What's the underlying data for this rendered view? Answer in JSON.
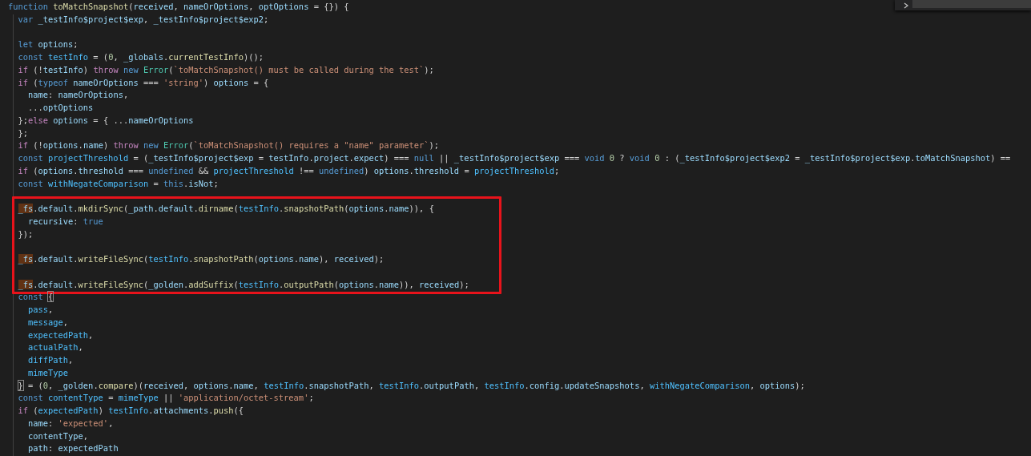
{
  "editor": {
    "groups": [
      {
        "boxed": false,
        "lines": [
          {
            "kind": "code",
            "tokens": [
              {
                "text": "function ",
                "kind": "kw"
              },
              {
                "text": "toMatchSnapshot",
                "kind": "fn"
              },
              {
                "text": "(",
                "kind": "p"
              },
              {
                "text": "received",
                "kind": "var"
              },
              {
                "text": ", ",
                "kind": "p"
              },
              {
                "text": "nameOrOptions",
                "kind": "var"
              },
              {
                "text": ", ",
                "kind": "p"
              },
              {
                "text": "optOptions",
                "kind": "var"
              },
              {
                "text": " = {}) {",
                "kind": "p"
              }
            ]
          },
          {
            "kind": "code",
            "tokens": [
              {
                "text": "  var ",
                "kind": "kw"
              },
              {
                "text": "_testInfo$project$exp",
                "kind": "var"
              },
              {
                "text": ", ",
                "kind": "p"
              },
              {
                "text": "_testInfo$project$exp2",
                "kind": "var"
              },
              {
                "text": ";",
                "kind": "p"
              }
            ]
          },
          {
            "kind": "blank"
          },
          {
            "kind": "code",
            "tokens": [
              {
                "text": "  let ",
                "kind": "kw"
              },
              {
                "text": "options",
                "kind": "var"
              },
              {
                "text": ";",
                "kind": "p"
              }
            ]
          },
          {
            "kind": "code",
            "tokens": [
              {
                "text": "  const ",
                "kind": "kw"
              },
              {
                "text": "testInfo",
                "kind": "const"
              },
              {
                "text": " = (",
                "kind": "p"
              },
              {
                "text": "0",
                "kind": "num"
              },
              {
                "text": ", ",
                "kind": "p"
              },
              {
                "text": "_globals",
                "kind": "var"
              },
              {
                "text": ".",
                "kind": "p"
              },
              {
                "text": "currentTestInfo",
                "kind": "fn"
              },
              {
                "text": ")();",
                "kind": "p"
              }
            ]
          },
          {
            "kind": "code",
            "tokens": [
              {
                "text": "  if",
                "kind": "ctl"
              },
              {
                "text": " (!",
                "kind": "p"
              },
              {
                "text": "testInfo",
                "kind": "var"
              },
              {
                "text": ") ",
                "kind": "p"
              },
              {
                "text": "throw ",
                "kind": "ctl"
              },
              {
                "text": "new ",
                "kind": "kw"
              },
              {
                "text": "Error",
                "kind": "cls"
              },
              {
                "text": "(",
                "kind": "p"
              },
              {
                "text": "`toMatchSnapshot() must be called during the test`",
                "kind": "str"
              },
              {
                "text": ");",
                "kind": "p"
              }
            ]
          },
          {
            "kind": "code",
            "tokens": [
              {
                "text": "  if",
                "kind": "ctl"
              },
              {
                "text": " (",
                "kind": "p"
              },
              {
                "text": "typeof ",
                "kind": "kw"
              },
              {
                "text": "nameOrOptions",
                "kind": "var"
              },
              {
                "text": " === ",
                "kind": "p"
              },
              {
                "text": "'string'",
                "kind": "str"
              },
              {
                "text": ") ",
                "kind": "p"
              },
              {
                "text": "options",
                "kind": "var"
              },
              {
                "text": " = {",
                "kind": "p"
              }
            ]
          },
          {
            "kind": "code",
            "tokens": [
              {
                "text": "    name",
                "kind": "var"
              },
              {
                "text": ": ",
                "kind": "p"
              },
              {
                "text": "nameOrOptions",
                "kind": "var"
              },
              {
                "text": ",",
                "kind": "p"
              }
            ]
          },
          {
            "kind": "code",
            "tokens": [
              {
                "text": "    ...",
                "kind": "p"
              },
              {
                "text": "optOptions",
                "kind": "var"
              }
            ]
          },
          {
            "kind": "code",
            "tokens": [
              {
                "text": "  };",
                "kind": "p"
              },
              {
                "text": "else ",
                "kind": "ctl"
              },
              {
                "text": "options",
                "kind": "var"
              },
              {
                "text": " = { ...",
                "kind": "p"
              },
              {
                "text": "nameOrOptions",
                "kind": "var"
              }
            ]
          },
          {
            "kind": "code",
            "tokens": [
              {
                "text": "  };",
                "kind": "p"
              }
            ]
          },
          {
            "kind": "code",
            "tokens": [
              {
                "text": "  if",
                "kind": "ctl"
              },
              {
                "text": " (!",
                "kind": "p"
              },
              {
                "text": "options",
                "kind": "var"
              },
              {
                "text": ".",
                "kind": "p"
              },
              {
                "text": "name",
                "kind": "var"
              },
              {
                "text": ") ",
                "kind": "p"
              },
              {
                "text": "throw ",
                "kind": "ctl"
              },
              {
                "text": "new ",
                "kind": "kw"
              },
              {
                "text": "Error",
                "kind": "cls"
              },
              {
                "text": "(",
                "kind": "p"
              },
              {
                "text": "`toMatchSnapshot() requires a \"name\" parameter`",
                "kind": "str"
              },
              {
                "text": ");",
                "kind": "p"
              }
            ]
          },
          {
            "kind": "code",
            "tokens": [
              {
                "text": "  const ",
                "kind": "kw"
              },
              {
                "text": "projectThreshold",
                "kind": "const"
              },
              {
                "text": " = (",
                "kind": "p"
              },
              {
                "text": "_testInfo$project$exp",
                "kind": "var"
              },
              {
                "text": " = ",
                "kind": "p"
              },
              {
                "text": "testInfo",
                "kind": "var"
              },
              {
                "text": ".",
                "kind": "p"
              },
              {
                "text": "project",
                "kind": "var"
              },
              {
                "text": ".",
                "kind": "p"
              },
              {
                "text": "expect",
                "kind": "var"
              },
              {
                "text": ") === ",
                "kind": "p"
              },
              {
                "text": "null",
                "kind": "kw"
              },
              {
                "text": " || ",
                "kind": "p"
              },
              {
                "text": "_testInfo$project$exp",
                "kind": "var"
              },
              {
                "text": " === ",
                "kind": "p"
              },
              {
                "text": "void ",
                "kind": "kw"
              },
              {
                "text": "0",
                "kind": "num"
              },
              {
                "text": " ? ",
                "kind": "p"
              },
              {
                "text": "void ",
                "kind": "kw"
              },
              {
                "text": "0",
                "kind": "num"
              },
              {
                "text": " : (",
                "kind": "p"
              },
              {
                "text": "_testInfo$project$exp2",
                "kind": "var"
              },
              {
                "text": " = ",
                "kind": "p"
              },
              {
                "text": "_testInfo$project$exp",
                "kind": "var"
              },
              {
                "text": ".",
                "kind": "p"
              },
              {
                "text": "toMatchSnapshot",
                "kind": "var"
              },
              {
                "text": ") ==",
                "kind": "p"
              }
            ]
          },
          {
            "kind": "code",
            "tokens": [
              {
                "text": "  if",
                "kind": "ctl"
              },
              {
                "text": " (",
                "kind": "p"
              },
              {
                "text": "options",
                "kind": "var"
              },
              {
                "text": ".",
                "kind": "p"
              },
              {
                "text": "threshold",
                "kind": "var"
              },
              {
                "text": " === ",
                "kind": "p"
              },
              {
                "text": "undefined",
                "kind": "kw"
              },
              {
                "text": " && ",
                "kind": "p"
              },
              {
                "text": "projectThreshold",
                "kind": "const"
              },
              {
                "text": " !== ",
                "kind": "p"
              },
              {
                "text": "undefined",
                "kind": "kw"
              },
              {
                "text": ") ",
                "kind": "p"
              },
              {
                "text": "options",
                "kind": "var"
              },
              {
                "text": ".",
                "kind": "p"
              },
              {
                "text": "threshold",
                "kind": "var"
              },
              {
                "text": " = ",
                "kind": "p"
              },
              {
                "text": "projectThreshold",
                "kind": "const"
              },
              {
                "text": ";",
                "kind": "p"
              }
            ]
          },
          {
            "kind": "code",
            "tokens": [
              {
                "text": "  const ",
                "kind": "kw"
              },
              {
                "text": "withNegateComparison",
                "kind": "const"
              },
              {
                "text": " = ",
                "kind": "p"
              },
              {
                "text": "this",
                "kind": "kw"
              },
              {
                "text": ".",
                "kind": "p"
              },
              {
                "text": "isNot",
                "kind": "var"
              },
              {
                "text": ";",
                "kind": "p"
              }
            ]
          }
        ]
      },
      {
        "boxed": true,
        "lines": [
          {
            "kind": "blank"
          },
          {
            "kind": "code",
            "tokens": [
              {
                "text": "_fs",
                "kind": "match"
              },
              {
                "text": ".",
                "kind": "p"
              },
              {
                "text": "default",
                "kind": "var"
              },
              {
                "text": ".",
                "kind": "p"
              },
              {
                "text": "mkdirSync",
                "kind": "fn"
              },
              {
                "text": "(",
                "kind": "p"
              },
              {
                "text": "_path",
                "kind": "var"
              },
              {
                "text": ".",
                "kind": "p"
              },
              {
                "text": "default",
                "kind": "var"
              },
              {
                "text": ".",
                "kind": "p"
              },
              {
                "text": "dirname",
                "kind": "fn"
              },
              {
                "text": "(",
                "kind": "p"
              },
              {
                "text": "testInfo",
                "kind": "const"
              },
              {
                "text": ".",
                "kind": "p"
              },
              {
                "text": "snapshotPath",
                "kind": "fn"
              },
              {
                "text": "(",
                "kind": "p"
              },
              {
                "text": "options",
                "kind": "var"
              },
              {
                "text": ".",
                "kind": "p"
              },
              {
                "text": "name",
                "kind": "var"
              },
              {
                "text": ")), {",
                "kind": "p"
              }
            ]
          },
          {
            "kind": "code",
            "tokens": [
              {
                "text": "  recursive",
                "kind": "var"
              },
              {
                "text": ": ",
                "kind": "p"
              },
              {
                "text": "true",
                "kind": "kw"
              }
            ]
          },
          {
            "kind": "code",
            "tokens": [
              {
                "text": "});",
                "kind": "p"
              }
            ]
          },
          {
            "kind": "blank"
          },
          {
            "kind": "code",
            "tokens": [
              {
                "text": "_fs",
                "kind": "match"
              },
              {
                "text": ".",
                "kind": "p"
              },
              {
                "text": "default",
                "kind": "var"
              },
              {
                "text": ".",
                "kind": "p"
              },
              {
                "text": "writeFileSync",
                "kind": "fn"
              },
              {
                "text": "(",
                "kind": "p"
              },
              {
                "text": "testInfo",
                "kind": "const"
              },
              {
                "text": ".",
                "kind": "p"
              },
              {
                "text": "snapshotPath",
                "kind": "fn"
              },
              {
                "text": "(",
                "kind": "p"
              },
              {
                "text": "options",
                "kind": "var"
              },
              {
                "text": ".",
                "kind": "p"
              },
              {
                "text": "name",
                "kind": "var"
              },
              {
                "text": "), ",
                "kind": "p"
              },
              {
                "text": "received",
                "kind": "var"
              },
              {
                "text": ");",
                "kind": "p"
              }
            ]
          },
          {
            "kind": "blank"
          },
          {
            "kind": "code",
            "tokens": [
              {
                "text": "_fs",
                "kind": "match"
              },
              {
                "text": ".",
                "kind": "p"
              },
              {
                "text": "default",
                "kind": "var"
              },
              {
                "text": ".",
                "kind": "p"
              },
              {
                "text": "writeFileSync",
                "kind": "fn"
              },
              {
                "text": "(",
                "kind": "p"
              },
              {
                "text": "_golden",
                "kind": "var"
              },
              {
                "text": ".",
                "kind": "p"
              },
              {
                "text": "addSuffix",
                "kind": "fn"
              },
              {
                "text": "(",
                "kind": "p"
              },
              {
                "text": "testInfo",
                "kind": "const"
              },
              {
                "text": ".",
                "kind": "p"
              },
              {
                "text": "outputPath",
                "kind": "fn"
              },
              {
                "text": "(",
                "kind": "p"
              },
              {
                "text": "options",
                "kind": "var"
              },
              {
                "text": ".",
                "kind": "p"
              },
              {
                "text": "name",
                "kind": "var"
              },
              {
                "text": ")), ",
                "kind": "p"
              },
              {
                "text": "received",
                "kind": "var"
              },
              {
                "text": ");",
                "kind": "p"
              }
            ]
          }
        ]
      },
      {
        "boxed": false,
        "lines": [
          {
            "kind": "code",
            "tokens": [
              {
                "text": "  const ",
                "kind": "kw"
              },
              {
                "text": "{",
                "kind": "brk"
              }
            ]
          },
          {
            "kind": "code",
            "tokens": [
              {
                "text": "    pass",
                "kind": "const"
              },
              {
                "text": ",",
                "kind": "p"
              }
            ]
          },
          {
            "kind": "code",
            "tokens": [
              {
                "text": "    message",
                "kind": "const"
              },
              {
                "text": ",",
                "kind": "p"
              }
            ]
          },
          {
            "kind": "code",
            "tokens": [
              {
                "text": "    expectedPath",
                "kind": "const"
              },
              {
                "text": ",",
                "kind": "p"
              }
            ]
          },
          {
            "kind": "code",
            "tokens": [
              {
                "text": "    actualPath",
                "kind": "const"
              },
              {
                "text": ",",
                "kind": "p"
              }
            ]
          },
          {
            "kind": "code",
            "tokens": [
              {
                "text": "    diffPath",
                "kind": "const"
              },
              {
                "text": ",",
                "kind": "p"
              }
            ]
          },
          {
            "kind": "code",
            "tokens": [
              {
                "text": "    mimeType",
                "kind": "const"
              }
            ]
          },
          {
            "kind": "code",
            "tokens": [
              {
                "text": "}",
                "kind": "brk"
              },
              {
                "text": " = (",
                "kind": "p"
              },
              {
                "text": "0",
                "kind": "num"
              },
              {
                "text": ", ",
                "kind": "p"
              },
              {
                "text": "_golden",
                "kind": "var"
              },
              {
                "text": ".",
                "kind": "p"
              },
              {
                "text": "compare",
                "kind": "fn"
              },
              {
                "text": ")(",
                "kind": "p"
              },
              {
                "text": "received",
                "kind": "var"
              },
              {
                "text": ", ",
                "kind": "p"
              },
              {
                "text": "options",
                "kind": "var"
              },
              {
                "text": ".",
                "kind": "p"
              },
              {
                "text": "name",
                "kind": "var"
              },
              {
                "text": ", ",
                "kind": "p"
              },
              {
                "text": "testInfo",
                "kind": "const"
              },
              {
                "text": ".",
                "kind": "p"
              },
              {
                "text": "snapshotPath",
                "kind": "var"
              },
              {
                "text": ", ",
                "kind": "p"
              },
              {
                "text": "testInfo",
                "kind": "const"
              },
              {
                "text": ".",
                "kind": "p"
              },
              {
                "text": "outputPath",
                "kind": "var"
              },
              {
                "text": ", ",
                "kind": "p"
              },
              {
                "text": "testInfo",
                "kind": "const"
              },
              {
                "text": ".",
                "kind": "p"
              },
              {
                "text": "config",
                "kind": "var"
              },
              {
                "text": ".",
                "kind": "p"
              },
              {
                "text": "updateSnapshots",
                "kind": "var"
              },
              {
                "text": ", ",
                "kind": "p"
              },
              {
                "text": "withNegateComparison",
                "kind": "const"
              },
              {
                "text": ", ",
                "kind": "p"
              },
              {
                "text": "options",
                "kind": "var"
              },
              {
                "text": ");",
                "kind": "p"
              }
            ]
          },
          {
            "kind": "code",
            "tokens": [
              {
                "text": "  const ",
                "kind": "kw"
              },
              {
                "text": "contentType",
                "kind": "const"
              },
              {
                "text": " = ",
                "kind": "p"
              },
              {
                "text": "mimeType",
                "kind": "const"
              },
              {
                "text": " || ",
                "kind": "p"
              },
              {
                "text": "'application/octet-stream'",
                "kind": "str"
              },
              {
                "text": ";",
                "kind": "p"
              }
            ]
          },
          {
            "kind": "code",
            "tokens": [
              {
                "text": "  if",
                "kind": "ctl"
              },
              {
                "text": " (",
                "kind": "p"
              },
              {
                "text": "expectedPath",
                "kind": "const"
              },
              {
                "text": ") ",
                "kind": "p"
              },
              {
                "text": "testInfo",
                "kind": "const"
              },
              {
                "text": ".",
                "kind": "p"
              },
              {
                "text": "attachments",
                "kind": "var"
              },
              {
                "text": ".",
                "kind": "p"
              },
              {
                "text": "push",
                "kind": "fn"
              },
              {
                "text": "({",
                "kind": "p"
              }
            ]
          },
          {
            "kind": "code",
            "tokens": [
              {
                "text": "    name",
                "kind": "var"
              },
              {
                "text": ": ",
                "kind": "p"
              },
              {
                "text": "'expected'",
                "kind": "str"
              },
              {
                "text": ",",
                "kind": "p"
              }
            ]
          },
          {
            "kind": "code",
            "tokens": [
              {
                "text": "    contentType",
                "kind": "var"
              },
              {
                "text": ",",
                "kind": "p"
              }
            ]
          },
          {
            "kind": "code",
            "tokens": [
              {
                "text": "    path",
                "kind": "var"
              },
              {
                "text": ": ",
                "kind": "p"
              },
              {
                "text": "expectedPath",
                "kind": "var"
              }
            ]
          }
        ]
      }
    ]
  }
}
